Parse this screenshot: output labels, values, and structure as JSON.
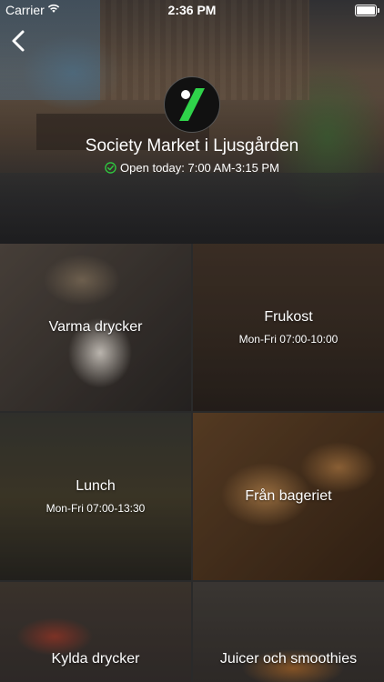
{
  "status_bar": {
    "carrier": "Carrier",
    "time": "2:36 PM"
  },
  "store": {
    "name": "Society Market i Ljusgården",
    "open_text": "Open today: 7:00 AM-3:15 PM",
    "open_color": "#2ecc40",
    "logo_accent": "#2fd34a"
  },
  "categories": [
    {
      "title": "Varma drycker",
      "hours": ""
    },
    {
      "title": "Frukost",
      "hours": "Mon-Fri 07:00-10:00"
    },
    {
      "title": "Lunch",
      "hours": "Mon-Fri 07:00-13:30"
    },
    {
      "title": "Från bageriet",
      "hours": ""
    },
    {
      "title": "Kylda drycker",
      "hours": ""
    },
    {
      "title": "Juicer och smoothies",
      "hours": ""
    }
  ]
}
